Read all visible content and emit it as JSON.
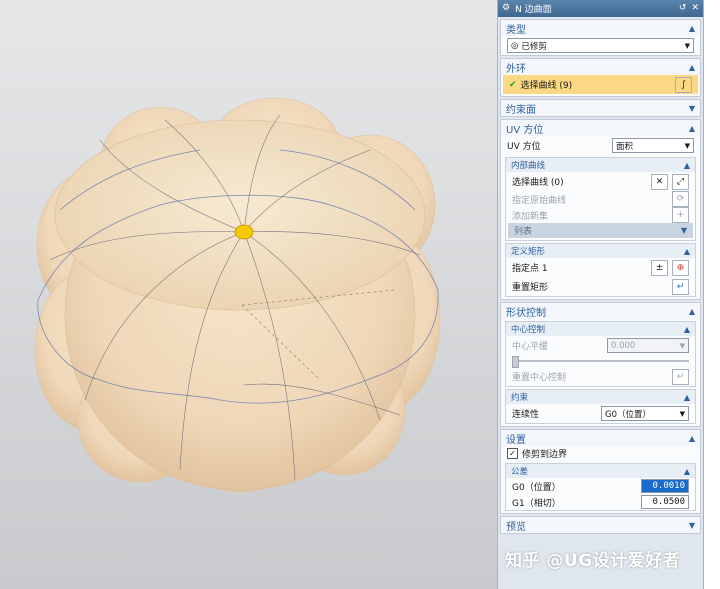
{
  "panel": {
    "title": "N 边曲面",
    "sections": {
      "type": {
        "title": "类型",
        "dropdown_value": "已修剪"
      },
      "outer_loop": {
        "title": "外环",
        "select_label": "选择曲线 (9)"
      },
      "constraint_face": {
        "title": "约束面"
      },
      "uv": {
        "title": "UV 方位",
        "uv_label": "UV 方位",
        "uv_value": "面积",
        "inner_curves": {
          "title": "内部曲线",
          "select_label": "选择曲线 (0)",
          "origin_label": "指定原始曲线",
          "add_set_label": "添加新集",
          "list_label": "列表"
        },
        "rect": {
          "title": "定义矩形",
          "point_label": "指定点 1",
          "reset_label": "重置矩形"
        }
      },
      "shape": {
        "title": "形状控制",
        "center": {
          "title": "中心控制",
          "flat_label": "中心平缓",
          "flat_value": "0.000",
          "reset_label": "重置中心控制"
        },
        "constraint": {
          "title": "约束",
          "cont_label": "连续性",
          "cont_value": "G0（位置）"
        }
      },
      "settings": {
        "title": "设置",
        "trim_label": "修剪到边界",
        "tolerance": {
          "title": "公差",
          "g0_label": "G0（位置）",
          "g0_value": "0.0010",
          "g1_label": "G1（相切）",
          "g1_value": "0.0500"
        }
      },
      "preview": {
        "title": "预览"
      }
    }
  },
  "watermark": "知乎 @UG设计爱好者",
  "colors": {
    "accent": "#2f60a0",
    "title_bar": "#4a74a0",
    "selection": "#fbd883",
    "highlight": "#1a6ccc",
    "surface": "#f2dcc0",
    "center_point": "#f6c800"
  },
  "icons": [
    "gear-icon",
    "reset-icon",
    "close-icon",
    "chevron-up-icon",
    "chevron-down-icon",
    "check-icon",
    "curve-icon",
    "point-icon",
    "enter-icon"
  ]
}
